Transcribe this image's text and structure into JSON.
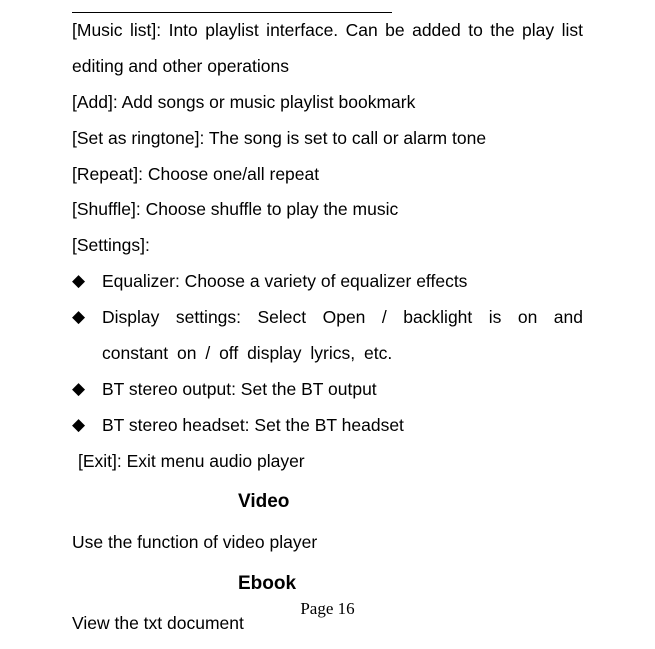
{
  "lines": {
    "music_list": "[Music list]: Into playlist interface. Can be added to the play list editing and other operations",
    "add": "[Add]: Add songs or music playlist bookmark",
    "ringtone": "[Set as ringtone]: The song is set to call or alarm tone",
    "repeat": "[Repeat]: Choose one/all repeat",
    "shuffle": "[Shuffle]: Choose shuffle to play the music",
    "settings": "[Settings]:",
    "exit": "[Exit]: Exit menu audio player"
  },
  "bullets": {
    "b1": " Equalizer: Choose a variety of equalizer effects",
    "b2": "Display settings: Select Open / backlight is on and constant on / off display lyrics, etc.",
    "b3": "BT stereo output: Set the BT output",
    "b4": "BT stereo headset: Set the BT headset"
  },
  "headings": {
    "video": "Video",
    "ebook": "Ebook"
  },
  "body": {
    "video_desc": "Use the function of video player",
    "ebook_desc": "View the txt document"
  },
  "page": "Page 16",
  "diamond": "◆"
}
